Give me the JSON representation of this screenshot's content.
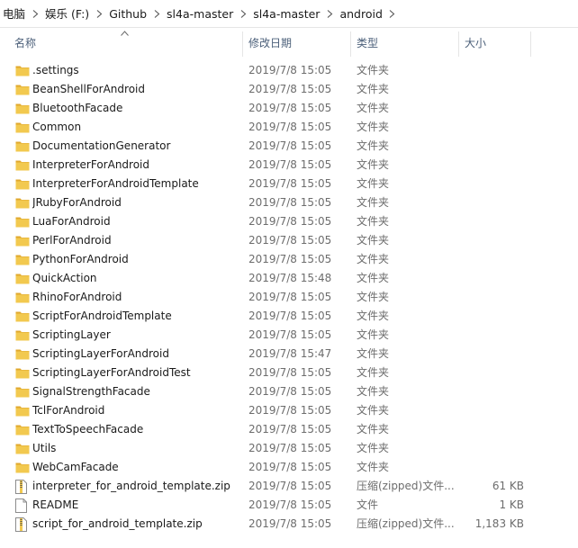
{
  "breadcrumb": [
    {
      "label": "电脑"
    },
    {
      "label": "娱乐 (F:)"
    },
    {
      "label": "Github"
    },
    {
      "label": "sl4a-master"
    },
    {
      "label": "sl4a-master"
    },
    {
      "label": "android"
    }
  ],
  "columns": {
    "name": "名称",
    "date": "修改日期",
    "type": "类型",
    "size": "大小"
  },
  "sort": {
    "column": "name",
    "direction": "ascending"
  },
  "colors": {
    "folder": "#f2c94f",
    "folder_tab": "#e0a82e",
    "header_text": "#4c607a",
    "meta_text": "#6d6d6d"
  },
  "files": [
    {
      "name": ".settings",
      "date": "2019/7/8 15:05",
      "type": "文件夹",
      "size": "",
      "icon": "folder-icon"
    },
    {
      "name": "BeanShellForAndroid",
      "date": "2019/7/8 15:05",
      "type": "文件夹",
      "size": "",
      "icon": "folder-icon"
    },
    {
      "name": "BluetoothFacade",
      "date": "2019/7/8 15:05",
      "type": "文件夹",
      "size": "",
      "icon": "folder-icon"
    },
    {
      "name": "Common",
      "date": "2019/7/8 15:05",
      "type": "文件夹",
      "size": "",
      "icon": "folder-icon"
    },
    {
      "name": "DocumentationGenerator",
      "date": "2019/7/8 15:05",
      "type": "文件夹",
      "size": "",
      "icon": "folder-icon"
    },
    {
      "name": "InterpreterForAndroid",
      "date": "2019/7/8 15:05",
      "type": "文件夹",
      "size": "",
      "icon": "folder-icon"
    },
    {
      "name": "InterpreterForAndroidTemplate",
      "date": "2019/7/8 15:05",
      "type": "文件夹",
      "size": "",
      "icon": "folder-icon"
    },
    {
      "name": "JRubyForAndroid",
      "date": "2019/7/8 15:05",
      "type": "文件夹",
      "size": "",
      "icon": "folder-icon"
    },
    {
      "name": "LuaForAndroid",
      "date": "2019/7/8 15:05",
      "type": "文件夹",
      "size": "",
      "icon": "folder-icon"
    },
    {
      "name": "PerlForAndroid",
      "date": "2019/7/8 15:05",
      "type": "文件夹",
      "size": "",
      "icon": "folder-icon"
    },
    {
      "name": "PythonForAndroid",
      "date": "2019/7/8 15:05",
      "type": "文件夹",
      "size": "",
      "icon": "folder-icon"
    },
    {
      "name": "QuickAction",
      "date": "2019/7/8 15:48",
      "type": "文件夹",
      "size": "",
      "icon": "folder-icon"
    },
    {
      "name": "RhinoForAndroid",
      "date": "2019/7/8 15:05",
      "type": "文件夹",
      "size": "",
      "icon": "folder-icon"
    },
    {
      "name": "ScriptForAndroidTemplate",
      "date": "2019/7/8 15:05",
      "type": "文件夹",
      "size": "",
      "icon": "folder-icon"
    },
    {
      "name": "ScriptingLayer",
      "date": "2019/7/8 15:05",
      "type": "文件夹",
      "size": "",
      "icon": "folder-icon"
    },
    {
      "name": "ScriptingLayerForAndroid",
      "date": "2019/7/8 15:47",
      "type": "文件夹",
      "size": "",
      "icon": "folder-icon"
    },
    {
      "name": "ScriptingLayerForAndroidTest",
      "date": "2019/7/8 15:05",
      "type": "文件夹",
      "size": "",
      "icon": "folder-icon"
    },
    {
      "name": "SignalStrengthFacade",
      "date": "2019/7/8 15:05",
      "type": "文件夹",
      "size": "",
      "icon": "folder-icon"
    },
    {
      "name": "TclForAndroid",
      "date": "2019/7/8 15:05",
      "type": "文件夹",
      "size": "",
      "icon": "folder-icon"
    },
    {
      "name": "TextToSpeechFacade",
      "date": "2019/7/8 15:05",
      "type": "文件夹",
      "size": "",
      "icon": "folder-icon"
    },
    {
      "name": "Utils",
      "date": "2019/7/8 15:05",
      "type": "文件夹",
      "size": "",
      "icon": "folder-icon"
    },
    {
      "name": "WebCamFacade",
      "date": "2019/7/8 15:05",
      "type": "文件夹",
      "size": "",
      "icon": "folder-icon"
    },
    {
      "name": "interpreter_for_android_template.zip",
      "date": "2019/7/8 15:05",
      "type": "压缩(zipped)文件...",
      "size": "61 KB",
      "icon": "zip-file-icon"
    },
    {
      "name": "README",
      "date": "2019/7/8 15:05",
      "type": "文件",
      "size": "1 KB",
      "icon": "file-icon"
    },
    {
      "name": "script_for_android_template.zip",
      "date": "2019/7/8 15:05",
      "type": "压缩(zipped)文件...",
      "size": "1,183 KB",
      "icon": "zip-file-icon"
    }
  ]
}
